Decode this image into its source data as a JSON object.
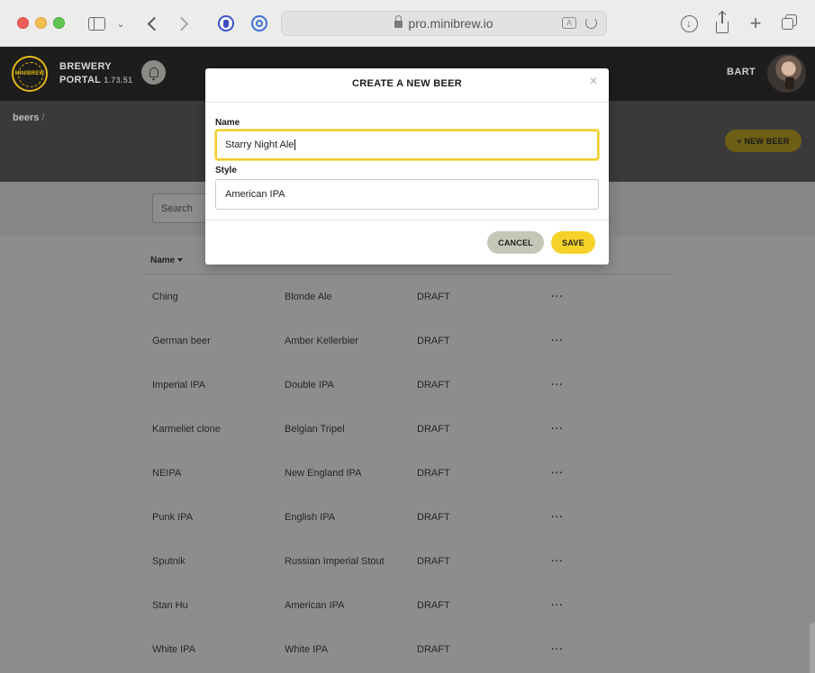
{
  "browser": {
    "url": "pro.minibrew.io",
    "translate_glyph": "A"
  },
  "app": {
    "logo_text": "MINIBREW",
    "portal_title_line1": "BREWERY",
    "portal_title_line2": "PORTAL",
    "version": "1.73.51",
    "user_name": "BART",
    "accent_color": "#f5d328"
  },
  "subheader": {
    "breadcrumb": "beers",
    "breadcrumb_separator": "/",
    "new_beer_label": "+ NEW BEER"
  },
  "filters": {
    "search_placeholder": "Search"
  },
  "table": {
    "header_name": "Name",
    "rows": [
      {
        "name": "Ching",
        "style": "Blonde Ale",
        "status": "DRAFT",
        "more": "···"
      },
      {
        "name": "German beer",
        "style": "Amber Kellerbier",
        "status": "DRAFT",
        "more": "···"
      },
      {
        "name": "Imperial IPA",
        "style": "Double IPA",
        "status": "DRAFT",
        "more": "···"
      },
      {
        "name": "Karmeliet clone",
        "style": "Belgian Tripel",
        "status": "DRAFT",
        "more": "···"
      },
      {
        "name": "NEIPA",
        "style": "New England IPA",
        "status": "DRAFT",
        "more": "···"
      },
      {
        "name": "Punk IPA",
        "style": "English IPA",
        "status": "DRAFT",
        "more": "···"
      },
      {
        "name": "Sputnik",
        "style": "Russian Imperial Stout",
        "status": "DRAFT",
        "more": "···"
      },
      {
        "name": "Stan Hu",
        "style": "American IPA",
        "status": "DRAFT",
        "more": "···"
      },
      {
        "name": "White IPA",
        "style": "White IPA",
        "status": "DRAFT",
        "more": "···"
      }
    ]
  },
  "modal": {
    "title": "CREATE A NEW BEER",
    "close_glyph": "✕",
    "name_label": "Name",
    "name_value": "Starry Night Ale",
    "style_label": "Style",
    "style_value": "American IPA",
    "cancel_label": "CANCEL",
    "save_label": "SAVE"
  }
}
